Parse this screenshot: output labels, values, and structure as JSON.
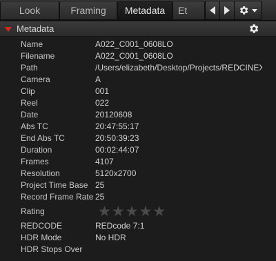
{
  "tabs": [
    {
      "label": "Look"
    },
    {
      "label": "Framing"
    },
    {
      "label": "Metadata"
    },
    {
      "label": "Et"
    }
  ],
  "section": {
    "title": "Metadata"
  },
  "metadata": [
    {
      "label": "Name",
      "value": "A022_C001_0608LO"
    },
    {
      "label": "Filename",
      "value": "A022_C001_0608LO"
    },
    {
      "label": "Path",
      "value": "/Users/elizabeth/Desktop/Projects/REDCINEX"
    },
    {
      "label": "Camera",
      "value": "A"
    },
    {
      "label": "Clip",
      "value": "001"
    },
    {
      "label": "Reel",
      "value": "022"
    },
    {
      "label": "Date",
      "value": "20120608"
    },
    {
      "label": "Abs TC",
      "value": "20:47:55:17"
    },
    {
      "label": "End Abs TC",
      "value": "20:50:39:23"
    },
    {
      "label": "Duration",
      "value": "00:02:44:07"
    },
    {
      "label": "Frames",
      "value": "4107"
    },
    {
      "label": "Resolution",
      "value": "5120x2700"
    },
    {
      "label": "Project Time Base",
      "value": "25"
    },
    {
      "label": "Record Frame Rate",
      "value": "25"
    }
  ],
  "rating": {
    "label": "Rating",
    "stars_total": 5,
    "stars_filled": 0
  },
  "metadata_after": [
    {
      "label": "REDCODE",
      "value": "REDcode 7:1"
    },
    {
      "label": "HDR Mode",
      "value": "No HDR"
    },
    {
      "label": "HDR Stops Over",
      "value": ""
    }
  ],
  "colors": {
    "accent_disclosure": "#e2231a",
    "background": "#1c1c1c",
    "text": "#c9c9c9"
  },
  "icons": [
    "chevron-left-icon",
    "chevron-right-icon",
    "gear-icon",
    "caret-down-icon",
    "disclosure-triangle-icon",
    "star-icon"
  ]
}
